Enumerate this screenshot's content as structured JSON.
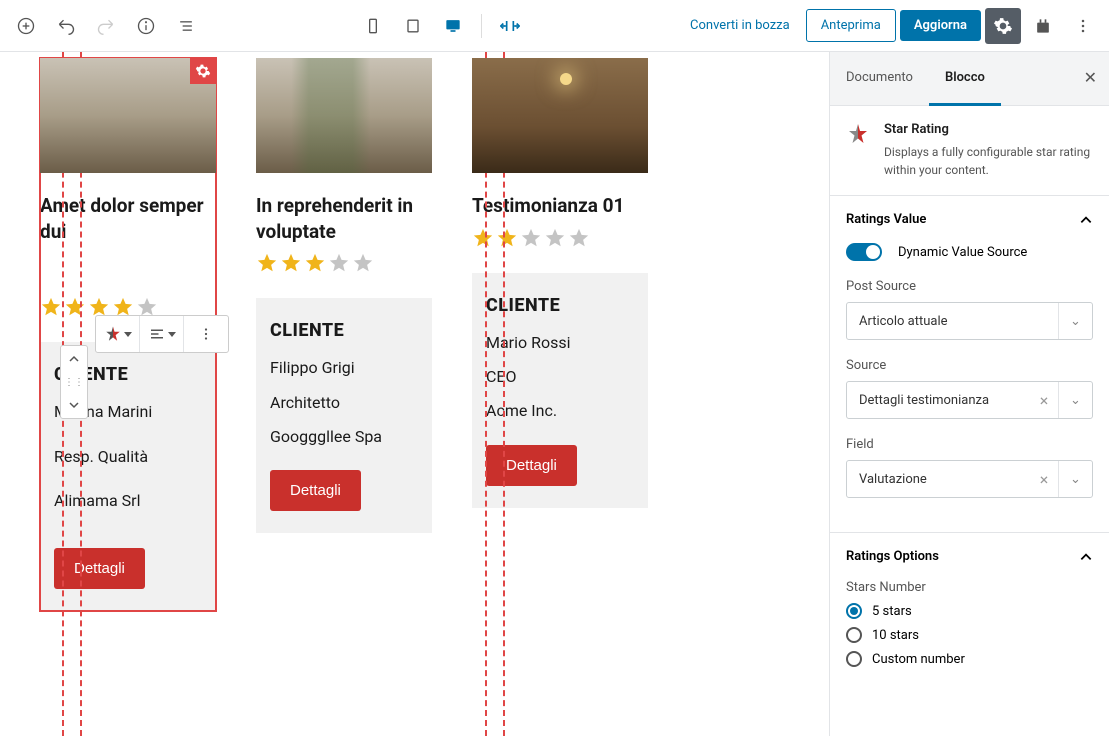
{
  "toolbar": {
    "convert_draft": "Converti in bozza",
    "preview": "Anteprima",
    "update": "Aggiorna"
  },
  "cards": [
    {
      "title": "Amet dolor semper dui",
      "rating": 4,
      "client_label": "CLIENTE",
      "name": "Marina Marini",
      "role": "Resp. Qualità",
      "company": "Alimama Srl",
      "button": "Dettagli"
    },
    {
      "title": "In reprehenderit in voluptate",
      "rating": 3,
      "client_label": "CLIENTE",
      "name": "Filippo Grigi",
      "role": "Architetto",
      "company": "Googggllee Spa",
      "button": "Dettagli"
    },
    {
      "title": "Testimonianza 01",
      "rating": 2,
      "client_label": "CLIENTE",
      "name": "Mario Rossi",
      "role": "CEO",
      "company": "Acme Inc.",
      "button": "Dettagli"
    }
  ],
  "sidebar": {
    "tab_document": "Documento",
    "tab_block": "Blocco",
    "block_name": "Star Rating",
    "block_desc": "Displays a fully configurable star rating within your content.",
    "panel_ratings_value": "Ratings Value",
    "dynamic_label": "Dynamic Value Source",
    "post_source_label": "Post Source",
    "post_source_value": "Articolo attuale",
    "source_label": "Source",
    "source_value": "Dettagli testimonianza",
    "field_label": "Field",
    "field_value": "Valutazione",
    "panel_ratings_options": "Ratings Options",
    "stars_number_label": "Stars Number",
    "radio_5": "5 stars",
    "radio_10": "10 stars",
    "radio_custom": "Custom number"
  }
}
